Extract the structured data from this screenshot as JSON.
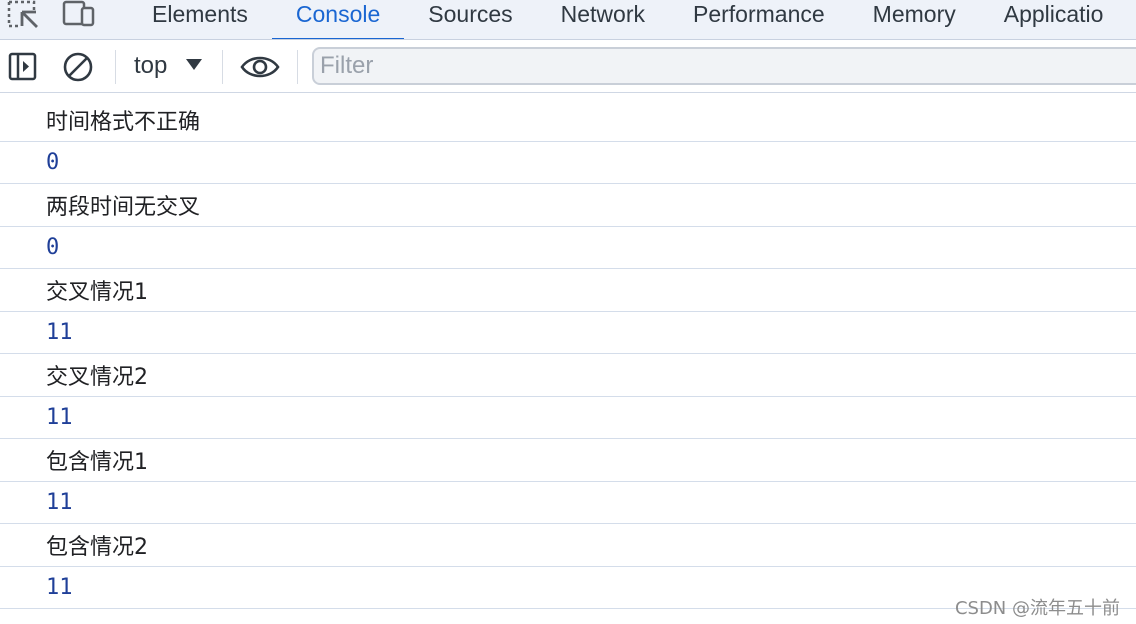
{
  "tabs": [
    {
      "label": "Elements",
      "active": false
    },
    {
      "label": "Console",
      "active": true
    },
    {
      "label": "Sources",
      "active": false
    },
    {
      "label": "Network",
      "active": false
    },
    {
      "label": "Performance",
      "active": false
    },
    {
      "label": "Memory",
      "active": false
    },
    {
      "label": "Applicatio",
      "active": false
    }
  ],
  "toolbar": {
    "context": "top",
    "filter_placeholder": "Filter"
  },
  "messages": [
    {
      "text": "时间格式不正确",
      "kind": "text"
    },
    {
      "text": "0",
      "kind": "number"
    },
    {
      "text": "两段时间无交叉",
      "kind": "text"
    },
    {
      "text": "0",
      "kind": "number"
    },
    {
      "text": "交叉情况1",
      "kind": "text"
    },
    {
      "text": "11",
      "kind": "number"
    },
    {
      "text": "交叉情况2",
      "kind": "text"
    },
    {
      "text": "11",
      "kind": "number"
    },
    {
      "text": "包含情况1",
      "kind": "text"
    },
    {
      "text": "11",
      "kind": "number"
    },
    {
      "text": "包含情况2",
      "kind": "text"
    },
    {
      "text": "11",
      "kind": "number"
    }
  ],
  "watermark": "CSDN @流年五十前",
  "colors": {
    "accent": "#1a66d2",
    "number": "#1f3f98",
    "text": "#202124"
  }
}
